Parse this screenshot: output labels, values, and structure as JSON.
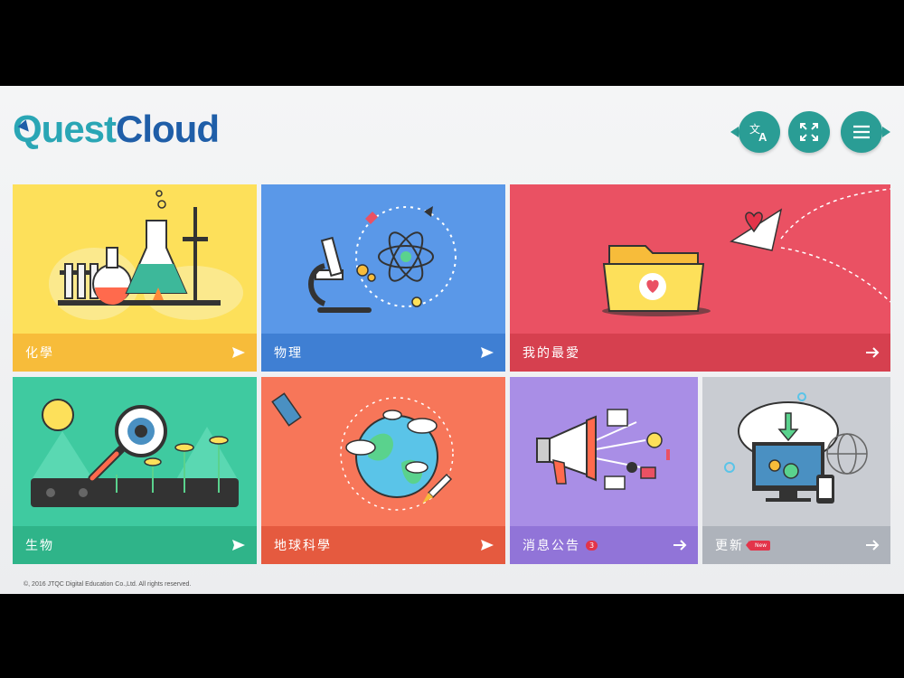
{
  "app": {
    "logo_part1": "Quest",
    "logo_part2": "Cloud",
    "copyright": "©, 2016 JTQC Digital Education Co.,Ltd. All rights reserved."
  },
  "header_buttons": {
    "translate_icon": "translate-icon",
    "fullscreen_icon": "fullscreen-icon",
    "menu_icon": "hamburger-menu-icon"
  },
  "tiles": {
    "chemistry": {
      "label": "化學",
      "color": "#fde05a",
      "bar_color": "#f7bc3a"
    },
    "physics": {
      "label": "物理",
      "color": "#5a98e8",
      "bar_color": "#3f7fd3"
    },
    "favorites": {
      "label": "我的最愛",
      "color": "#ea5163",
      "bar_color": "#d6404f"
    },
    "biology": {
      "label": "生物",
      "color": "#3fcaa0",
      "bar_color": "#2fb489"
    },
    "earth_science": {
      "label": "地球科學",
      "color": "#f77659",
      "bar_color": "#e55a3f"
    },
    "announcements": {
      "label": "消息公告",
      "badge": "3",
      "color": "#a98ee6",
      "bar_color": "#9174d8"
    },
    "update": {
      "label": "更新",
      "tag": "New",
      "color": "#c9ccd2",
      "bar_color": "#aeb3bb"
    }
  }
}
